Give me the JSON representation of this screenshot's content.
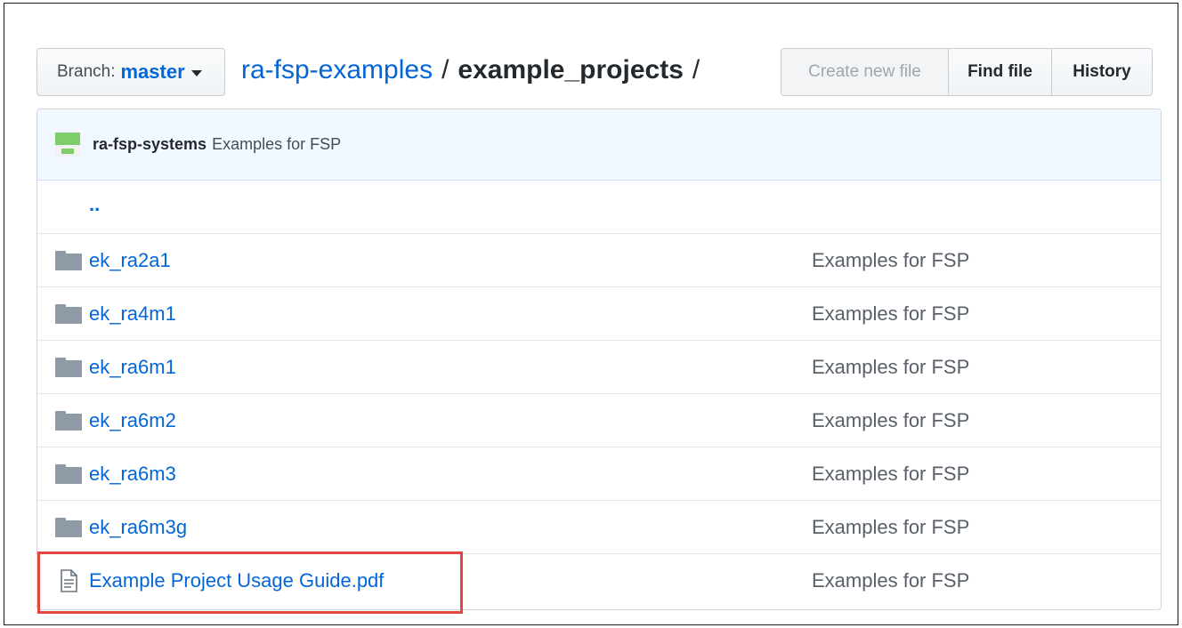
{
  "toolbar": {
    "branch_label": "Branch:",
    "branch_name": "master",
    "breadcrumb_repo": "ra-fsp-examples",
    "breadcrumb_sep1": "/",
    "breadcrumb_dir": "example_projects",
    "breadcrumb_sep2": "/",
    "create_new_file": "Create new file",
    "find_file": "Find file",
    "history": "History"
  },
  "commit": {
    "author": "ra-fsp-systems",
    "message": "Examples for FSP"
  },
  "up_link": "..",
  "files": [
    {
      "type": "folder",
      "name": "ek_ra2a1",
      "message": "Examples for FSP"
    },
    {
      "type": "folder",
      "name": "ek_ra4m1",
      "message": "Examples for FSP"
    },
    {
      "type": "folder",
      "name": "ek_ra6m1",
      "message": "Examples for FSP"
    },
    {
      "type": "folder",
      "name": "ek_ra6m2",
      "message": "Examples for FSP"
    },
    {
      "type": "folder",
      "name": "ek_ra6m3",
      "message": "Examples for FSP"
    },
    {
      "type": "folder",
      "name": "ek_ra6m3g",
      "message": "Examples for FSP"
    },
    {
      "type": "file",
      "name": "Example Project Usage Guide.pdf",
      "message": "Examples for FSP"
    }
  ],
  "colors": {
    "link": "#0366d6",
    "commit_bar": "#f1f8ff",
    "highlight": "#e2463f"
  }
}
